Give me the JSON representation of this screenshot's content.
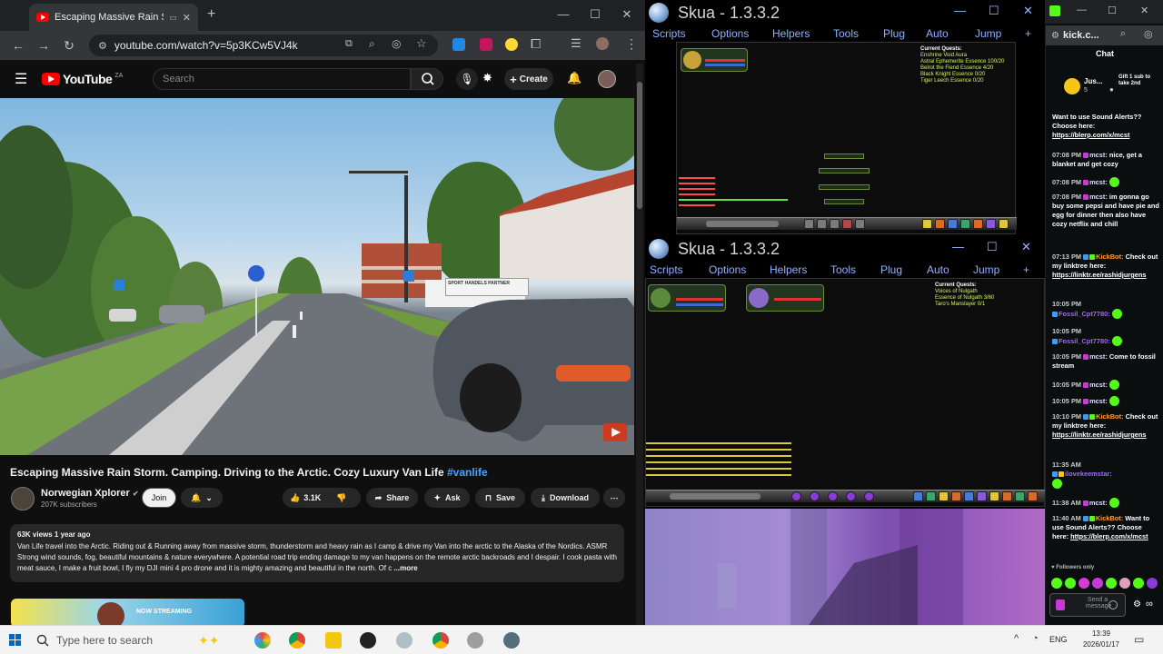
{
  "chrome": {
    "tab_title": "Escaping Massive Rain Storm",
    "url": "youtube.com/watch?v=5p3KCw5VJ4k"
  },
  "youtube": {
    "logo_text": "YouTube",
    "region": "ZA",
    "search_placeholder": "Search",
    "create_label": "Create",
    "video": {
      "title": "Escaping Massive Rain Storm. Camping. Driving to the Arctic. Cozy Luxury Van Life",
      "hashtag": "#vanlife",
      "sign_right": "SPORT HANDELS PARTNER"
    },
    "channel": {
      "name": "Norwegian Xplorer",
      "subs": "207K subscribers",
      "join": "Join"
    },
    "actions": {
      "likes": "3.1K",
      "share": "Share",
      "ask": "Ask",
      "save": "Save",
      "download": "Download"
    },
    "description": {
      "stats": "63K views  1 year ago",
      "text": "Van Life travel into the Arctic. Riding out & Running away from massive storm, thunderstorm and heavy rain as I camp & drive my Van into the arctic to the Alaska of the Nordics. ASMR Strong wind sounds, fog, beautiful mountains & nature everywhere. A potential road trip ending damage to my van happens on the remote arctic backroads and I despair. I cook pasta with meat sauce, I make a fruit bowl, I fly my DJI mini 4 pro drone and it is mighty amazing and beautiful in the north. Of c",
      "more": "...more"
    },
    "streaming_label": "NOW STREAMING"
  },
  "skua1": {
    "title": "Skua - 1.3.3.2",
    "menu": [
      "Scripts",
      "Options",
      "Helpers",
      "Tools",
      "Plug",
      "Auto",
      "Jump"
    ],
    "quest_title": "Current Quests:",
    "quests": [
      "Enshrine Void Aura",
      "Astral Ephemerite Essence 100/20",
      "Belrot the Fiend Essence 4/20",
      "Black Knight Essence 0/20",
      "Tiger Leech Essence 0/20"
    ]
  },
  "skua2": {
    "title": "Skua - 1.3.3.2",
    "menu": [
      "Scripts",
      "Options",
      "Helpers",
      "Tools",
      "Plug",
      "Auto",
      "Jump"
    ],
    "quest_title": "Current Quests:",
    "quests": [
      "Voices of Nulgath",
      "Essence of Nulgath 3/60",
      "Taro's Manslayer 0/1"
    ]
  },
  "kick": {
    "url": "kick.c...",
    "chat_label": "Chat",
    "gift_user": "Jus...",
    "gift_text": "Gift 1 sub to take 2nd",
    "messages": [
      {
        "time": "",
        "user": "",
        "text": "Want to use Sound Alerts?? Choose here:",
        "link": "https://blerp.com/x/mcst"
      },
      {
        "time": "07:08 PM",
        "user": "mcst:",
        "text": "nice, get a blanket and get cozy",
        "link": ""
      },
      {
        "time": "07:08 PM",
        "user": "mcst:",
        "text": "",
        "link": ""
      },
      {
        "time": "07:08 PM",
        "user": "mcst:",
        "text": "im gonna go buy some pepsi and have pie and egg for dinner then also have cozy netflix and chill",
        "link": ""
      },
      {
        "time": "07:13 PM",
        "user": "KickBot:",
        "text": "Check out my linktree here:",
        "link": "https://linktr.ee/rashidjurgens"
      },
      {
        "time": "10:05 PM",
        "user": "Fossil_Cpt7780:",
        "text": "",
        "link": ""
      },
      {
        "time": "10:05 PM",
        "user": "Fossil_Cpt7780:",
        "text": "",
        "link": ""
      },
      {
        "time": "10:05 PM",
        "user": "mcst:",
        "text": "Come to fossil stream",
        "link": ""
      },
      {
        "time": "10:05 PM",
        "user": "mcst:",
        "text": "",
        "link": ""
      },
      {
        "time": "10:05 PM",
        "user": "mcst:",
        "text": "",
        "link": ""
      },
      {
        "time": "10:10 PM",
        "user": "KickBot:",
        "text": "Check out my linktree here:",
        "link": "https://linktr.ee/rashidjurgens"
      },
      {
        "time": "11:35 AM",
        "user": "ilovekeemstar:",
        "text": "",
        "link": ""
      },
      {
        "time": "11:38 AM",
        "user": "mcst:",
        "text": "",
        "link": ""
      },
      {
        "time": "11:40 AM",
        "user": "KickBot:",
        "text": "Want to use Sound Alerts?? Choose here:",
        "link": "https://blerp.com/x/mcst"
      }
    ],
    "followers_only": "Followers only",
    "send_placeholder": "Send a message"
  },
  "taskbar": {
    "search": "Type here to search",
    "lang": "ENG",
    "time": "13:39",
    "date": "2026/01/17"
  }
}
